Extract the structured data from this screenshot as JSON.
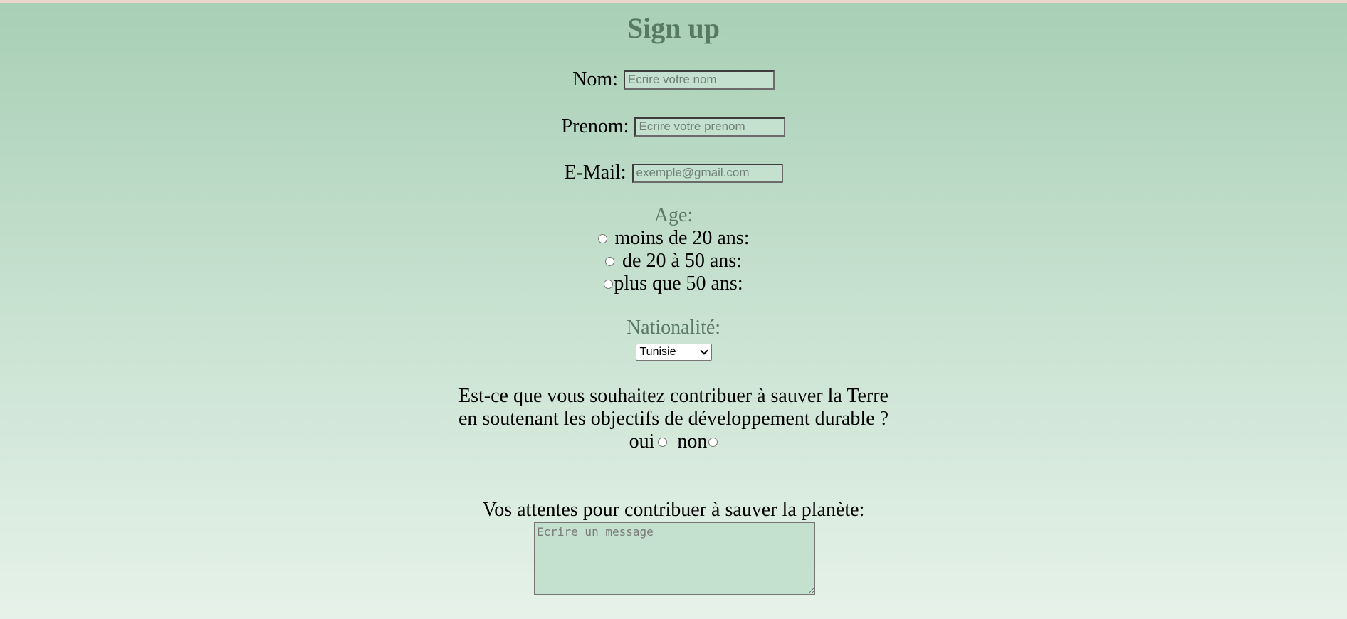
{
  "page": {
    "title": "Sign up"
  },
  "form": {
    "nom": {
      "label": "Nom:",
      "placeholder": "Ecrire votre nom",
      "value": ""
    },
    "prenom": {
      "label": "Prenom:",
      "placeholder": "Ecrire votre prenom",
      "value": ""
    },
    "email": {
      "label": "E-Mail:",
      "placeholder": "exemple@gmail.com",
      "value": ""
    },
    "age": {
      "label": "Age:",
      "options": [
        {
          "label": "moins de 20 ans:"
        },
        {
          "label": "de 20 à 50 ans:"
        },
        {
          "label": "plus que 50 ans:"
        }
      ]
    },
    "nationalite": {
      "label": "Nationalité:",
      "selected": "Tunisie"
    },
    "question": {
      "line1": "Est-ce que vous souhaitez contribuer à sauver la Terre",
      "line2": "en soutenant les objectifs de développement durable ?",
      "yes_label": "oui",
      "no_label": "non"
    },
    "attentes": {
      "label": "Vos attentes pour contribuer à sauver la planète:",
      "placeholder": "Ecrire un message",
      "value": ""
    }
  },
  "colors": {
    "heading": "#587a62",
    "input_bg": "#c4e0cf",
    "gradient_top": "#a8cfb5",
    "gradient_bottom": "#e6f2e9"
  }
}
